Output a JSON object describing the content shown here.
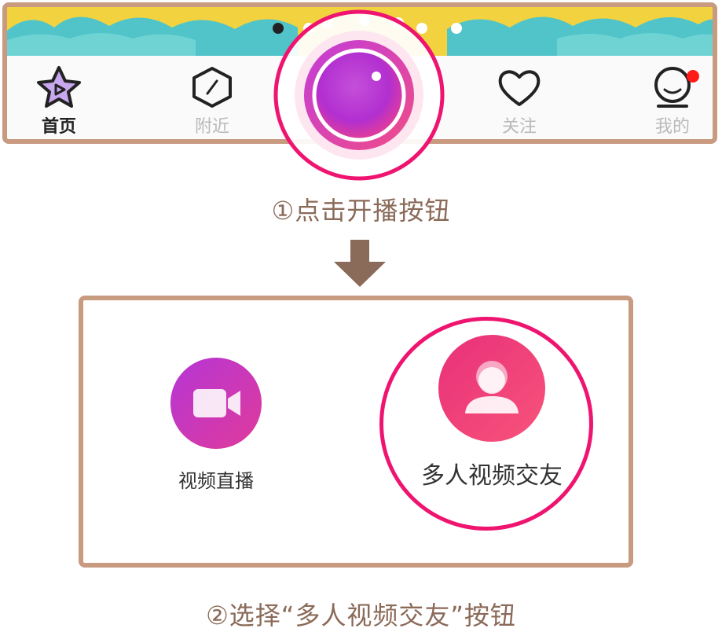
{
  "tab_bar": {
    "tabs": [
      {
        "label": "首页",
        "icon": "star-play-icon",
        "active": true
      },
      {
        "label": "附近",
        "icon": "hexagon-slash-icon",
        "active": false
      },
      {
        "label": "关注",
        "icon": "heart-icon",
        "active": false
      },
      {
        "label": "我的",
        "icon": "smiley-face-icon",
        "active": false,
        "badge": true
      }
    ],
    "center_button": {
      "icon": "camera-record-icon"
    }
  },
  "captions": {
    "step1": "①点击开播按钮",
    "step2": "②选择“多人视频交友”按钮"
  },
  "options": {
    "video_live": {
      "label": "视频直播",
      "icon": "video-camera-icon"
    },
    "multi_video": {
      "label": "多人视频交友",
      "icon": "group-users-icon"
    }
  },
  "colors": {
    "frame": "#c89a80",
    "caption": "#8a6a58",
    "highlight": "#ee1470",
    "badge": "#ff1a1a"
  }
}
